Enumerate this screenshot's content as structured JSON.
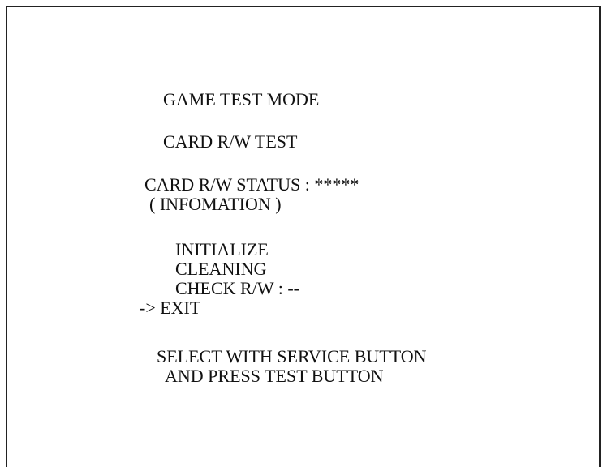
{
  "screen": {
    "title": "GAME TEST MODE",
    "subtitle": "CARD R/W TEST",
    "status": {
      "label": "CARD R/W STATUS :",
      "value": "*****",
      "info": "( INFOMATION )"
    },
    "menu": {
      "cursor": "->",
      "selected_index": 3,
      "items": [
        {
          "label": "INITIALIZE"
        },
        {
          "label": "CLEANING"
        },
        {
          "label": "CHECK R/W :",
          "value": "--"
        },
        {
          "label": "EXIT"
        }
      ]
    },
    "instructions": {
      "line1": "SELECT WITH SERVICE BUTTON",
      "line2": "AND PRESS TEST BUTTON"
    }
  }
}
